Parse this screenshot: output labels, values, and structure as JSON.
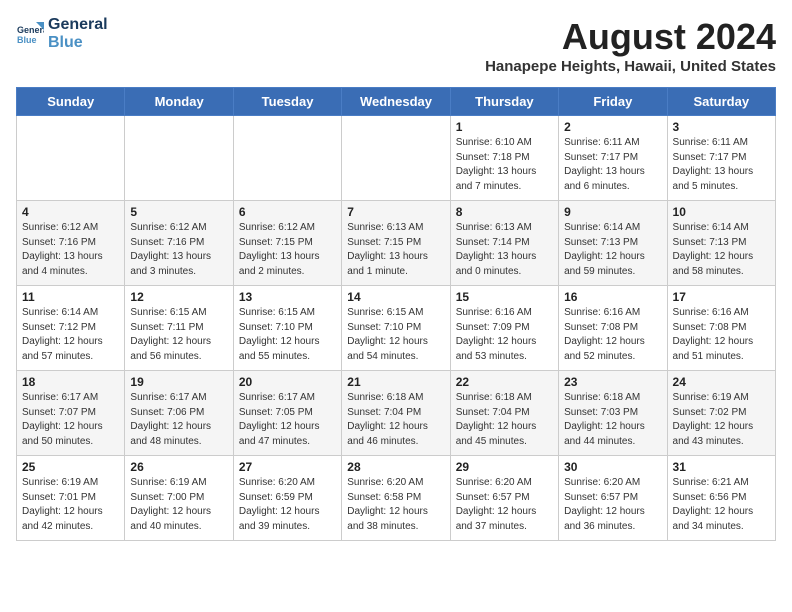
{
  "logo": {
    "line1": "General",
    "line2": "Blue"
  },
  "title": "August 2024",
  "subtitle": "Hanapepe Heights, Hawaii, United States",
  "weekdays": [
    "Sunday",
    "Monday",
    "Tuesday",
    "Wednesday",
    "Thursday",
    "Friday",
    "Saturday"
  ],
  "weeks": [
    [
      {
        "day": "",
        "info": ""
      },
      {
        "day": "",
        "info": ""
      },
      {
        "day": "",
        "info": ""
      },
      {
        "day": "",
        "info": ""
      },
      {
        "day": "1",
        "info": "Sunrise: 6:10 AM\nSunset: 7:18 PM\nDaylight: 13 hours\nand 7 minutes."
      },
      {
        "day": "2",
        "info": "Sunrise: 6:11 AM\nSunset: 7:17 PM\nDaylight: 13 hours\nand 6 minutes."
      },
      {
        "day": "3",
        "info": "Sunrise: 6:11 AM\nSunset: 7:17 PM\nDaylight: 13 hours\nand 5 minutes."
      }
    ],
    [
      {
        "day": "4",
        "info": "Sunrise: 6:12 AM\nSunset: 7:16 PM\nDaylight: 13 hours\nand 4 minutes."
      },
      {
        "day": "5",
        "info": "Sunrise: 6:12 AM\nSunset: 7:16 PM\nDaylight: 13 hours\nand 3 minutes."
      },
      {
        "day": "6",
        "info": "Sunrise: 6:12 AM\nSunset: 7:15 PM\nDaylight: 13 hours\nand 2 minutes."
      },
      {
        "day": "7",
        "info": "Sunrise: 6:13 AM\nSunset: 7:15 PM\nDaylight: 13 hours\nand 1 minute."
      },
      {
        "day": "8",
        "info": "Sunrise: 6:13 AM\nSunset: 7:14 PM\nDaylight: 13 hours\nand 0 minutes."
      },
      {
        "day": "9",
        "info": "Sunrise: 6:14 AM\nSunset: 7:13 PM\nDaylight: 12 hours\nand 59 minutes."
      },
      {
        "day": "10",
        "info": "Sunrise: 6:14 AM\nSunset: 7:13 PM\nDaylight: 12 hours\nand 58 minutes."
      }
    ],
    [
      {
        "day": "11",
        "info": "Sunrise: 6:14 AM\nSunset: 7:12 PM\nDaylight: 12 hours\nand 57 minutes."
      },
      {
        "day": "12",
        "info": "Sunrise: 6:15 AM\nSunset: 7:11 PM\nDaylight: 12 hours\nand 56 minutes."
      },
      {
        "day": "13",
        "info": "Sunrise: 6:15 AM\nSunset: 7:10 PM\nDaylight: 12 hours\nand 55 minutes."
      },
      {
        "day": "14",
        "info": "Sunrise: 6:15 AM\nSunset: 7:10 PM\nDaylight: 12 hours\nand 54 minutes."
      },
      {
        "day": "15",
        "info": "Sunrise: 6:16 AM\nSunset: 7:09 PM\nDaylight: 12 hours\nand 53 minutes."
      },
      {
        "day": "16",
        "info": "Sunrise: 6:16 AM\nSunset: 7:08 PM\nDaylight: 12 hours\nand 52 minutes."
      },
      {
        "day": "17",
        "info": "Sunrise: 6:16 AM\nSunset: 7:08 PM\nDaylight: 12 hours\nand 51 minutes."
      }
    ],
    [
      {
        "day": "18",
        "info": "Sunrise: 6:17 AM\nSunset: 7:07 PM\nDaylight: 12 hours\nand 50 minutes."
      },
      {
        "day": "19",
        "info": "Sunrise: 6:17 AM\nSunset: 7:06 PM\nDaylight: 12 hours\nand 48 minutes."
      },
      {
        "day": "20",
        "info": "Sunrise: 6:17 AM\nSunset: 7:05 PM\nDaylight: 12 hours\nand 47 minutes."
      },
      {
        "day": "21",
        "info": "Sunrise: 6:18 AM\nSunset: 7:04 PM\nDaylight: 12 hours\nand 46 minutes."
      },
      {
        "day": "22",
        "info": "Sunrise: 6:18 AM\nSunset: 7:04 PM\nDaylight: 12 hours\nand 45 minutes."
      },
      {
        "day": "23",
        "info": "Sunrise: 6:18 AM\nSunset: 7:03 PM\nDaylight: 12 hours\nand 44 minutes."
      },
      {
        "day": "24",
        "info": "Sunrise: 6:19 AM\nSunset: 7:02 PM\nDaylight: 12 hours\nand 43 minutes."
      }
    ],
    [
      {
        "day": "25",
        "info": "Sunrise: 6:19 AM\nSunset: 7:01 PM\nDaylight: 12 hours\nand 42 minutes."
      },
      {
        "day": "26",
        "info": "Sunrise: 6:19 AM\nSunset: 7:00 PM\nDaylight: 12 hours\nand 40 minutes."
      },
      {
        "day": "27",
        "info": "Sunrise: 6:20 AM\nSunset: 6:59 PM\nDaylight: 12 hours\nand 39 minutes."
      },
      {
        "day": "28",
        "info": "Sunrise: 6:20 AM\nSunset: 6:58 PM\nDaylight: 12 hours\nand 38 minutes."
      },
      {
        "day": "29",
        "info": "Sunrise: 6:20 AM\nSunset: 6:57 PM\nDaylight: 12 hours\nand 37 minutes."
      },
      {
        "day": "30",
        "info": "Sunrise: 6:20 AM\nSunset: 6:57 PM\nDaylight: 12 hours\nand 36 minutes."
      },
      {
        "day": "31",
        "info": "Sunrise: 6:21 AM\nSunset: 6:56 PM\nDaylight: 12 hours\nand 34 minutes."
      }
    ]
  ]
}
